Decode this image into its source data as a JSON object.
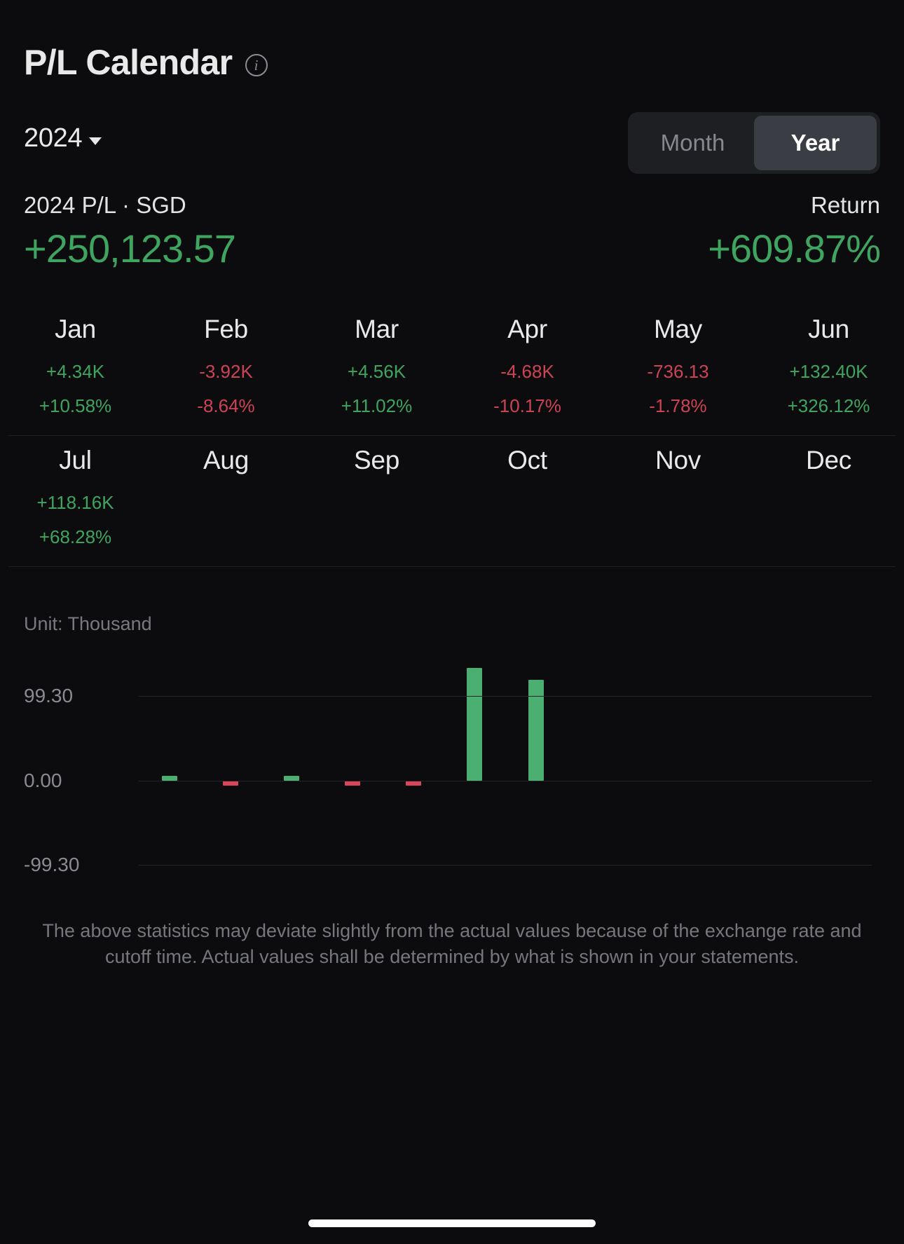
{
  "header": {
    "title": "P/L Calendar",
    "info_icon": "info-icon"
  },
  "controls": {
    "year": "2024",
    "caret_icon": "chevron-down-icon",
    "segments": [
      {
        "label": "Month",
        "active": false
      },
      {
        "label": "Year",
        "active": true
      }
    ]
  },
  "summary": {
    "pl_label": "2024 P/L · SGD",
    "pl_value": "+250,123.57",
    "return_label": "Return",
    "return_value": "+609.87%"
  },
  "months": [
    {
      "name": "Jan",
      "amount": "+4.34K",
      "percent": "+10.58%",
      "sign": "pos"
    },
    {
      "name": "Feb",
      "amount": "-3.92K",
      "percent": "-8.64%",
      "sign": "neg"
    },
    {
      "name": "Mar",
      "amount": "+4.56K",
      "percent": "+11.02%",
      "sign": "pos"
    },
    {
      "name": "Apr",
      "amount": "-4.68K",
      "percent": "-10.17%",
      "sign": "neg"
    },
    {
      "name": "May",
      "amount": "-736.13",
      "percent": "-1.78%",
      "sign": "neg"
    },
    {
      "name": "Jun",
      "amount": "+132.40K",
      "percent": "+326.12%",
      "sign": "pos"
    },
    {
      "name": "Jul",
      "amount": "+118.16K",
      "percent": "+68.28%",
      "sign": "pos"
    },
    {
      "name": "Aug",
      "amount": "",
      "percent": "",
      "sign": "none"
    },
    {
      "name": "Sep",
      "amount": "",
      "percent": "",
      "sign": "none"
    },
    {
      "name": "Oct",
      "amount": "",
      "percent": "",
      "sign": "none"
    },
    {
      "name": "Nov",
      "amount": "",
      "percent": "",
      "sign": "none"
    },
    {
      "name": "Dec",
      "amount": "",
      "percent": "",
      "sign": "none"
    }
  ],
  "chart_data": {
    "type": "bar",
    "title": "",
    "unit_label": "Unit: Thousand",
    "xlabel": "",
    "ylabel": "",
    "categories": [
      "Jan",
      "Feb",
      "Mar",
      "Apr",
      "May",
      "Jun",
      "Jul",
      "Aug",
      "Sep",
      "Oct",
      "Nov",
      "Dec"
    ],
    "values": [
      4.34,
      -3.92,
      4.56,
      -4.68,
      -0.73613,
      132.4,
      118.16,
      null,
      null,
      null,
      null,
      null
    ],
    "ytick_labels": [
      "99.30",
      "0.00",
      "-99.30"
    ],
    "ytick_values": [
      99.3,
      0.0,
      -99.3
    ],
    "ylim": [
      -99.3,
      140.0
    ],
    "grid": true,
    "legend": "none",
    "positive_color": "#4caf72",
    "negative_color": "#d9455a"
  },
  "colors": {
    "positive": "#3fa45f",
    "negative": "#cc4356",
    "background": "#0c0c0e",
    "text_primary": "#e9e9ea",
    "text_muted": "#78797e"
  },
  "footer": {
    "disclaimer": "The above statistics may deviate slightly from the actual values because of the exchange rate and cutoff time. Actual values shall be determined by what is shown in your statements."
  }
}
